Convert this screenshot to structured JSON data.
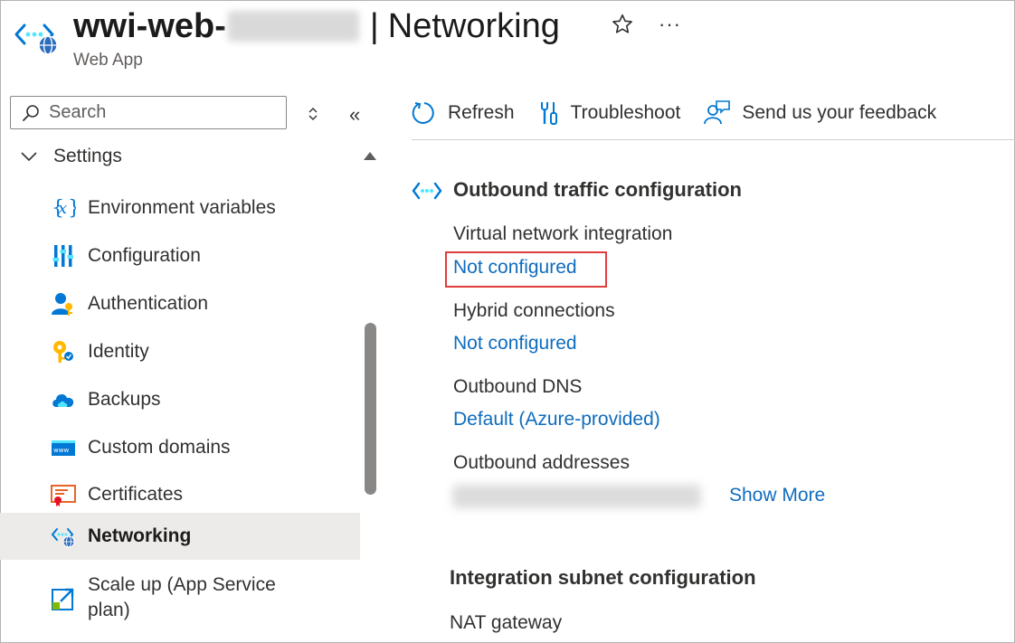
{
  "header": {
    "resource_name": "wwi-web-",
    "separator": "|",
    "page_title": "Networking",
    "subtitle": "Web App",
    "favorite_icon": "star-icon",
    "more_icon": "ellipsis-icon"
  },
  "search": {
    "placeholder": "Search"
  },
  "sidebar": {
    "group_label": "Settings",
    "items": [
      {
        "label": "Environment variables",
        "icon": "environment-variables-icon"
      },
      {
        "label": "Configuration",
        "icon": "configuration-icon"
      },
      {
        "label": "Authentication",
        "icon": "authentication-icon"
      },
      {
        "label": "Identity",
        "icon": "identity-icon"
      },
      {
        "label": "Backups",
        "icon": "backups-icon"
      },
      {
        "label": "Custom domains",
        "icon": "custom-domains-icon"
      },
      {
        "label": "Certificates",
        "icon": "certificates-icon"
      },
      {
        "label": "Networking",
        "icon": "networking-icon",
        "active": true
      },
      {
        "label": "Scale up (App Service plan)",
        "icon": "scale-up-icon"
      }
    ]
  },
  "toolbar": {
    "refresh_label": "Refresh",
    "troubleshoot_label": "Troubleshoot",
    "feedback_label": "Send us your feedback"
  },
  "outbound": {
    "title": "Outbound traffic configuration",
    "vnet_label": "Virtual network integration",
    "vnet_value": "Not configured",
    "hybrid_label": "Hybrid connections",
    "hybrid_value": "Not configured",
    "dns_label": "Outbound DNS",
    "dns_value": "Default (Azure-provided)",
    "addresses_label": "Outbound addresses",
    "show_more_label": "Show More"
  },
  "integration_subnet": {
    "title": "Integration subnet configuration",
    "nat_label": "NAT gateway"
  },
  "colors": {
    "link": "#0f6cbd",
    "accent": "#0078d4",
    "highlight_border": "#e03e3e",
    "active_nav_bg": "#edebe9"
  }
}
